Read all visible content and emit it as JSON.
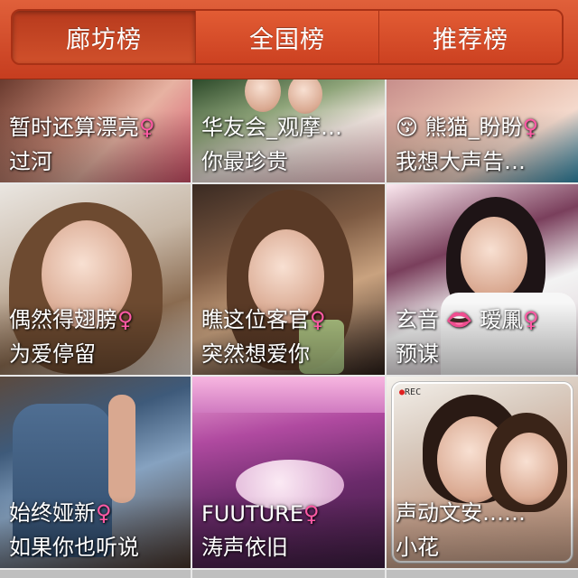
{
  "tabs": [
    {
      "label": "廊坊榜",
      "active": true
    },
    {
      "label": "全国榜",
      "active": false
    },
    {
      "label": "推荐榜",
      "active": false
    }
  ],
  "cards": [
    {
      "name": "暂时还算漂亮",
      "sub": "过河",
      "gender_symbol": "♀"
    },
    {
      "name": "华友会_观摩…",
      "sub": "你最珍贵",
      "gender_symbol": ""
    },
    {
      "name": "😚 熊猫_盼盼",
      "sub": "我想大声告…",
      "gender_symbol": "♀"
    },
    {
      "name": "偶然得翅膀",
      "sub": "为爱停留",
      "gender_symbol": "♀"
    },
    {
      "name": "瞧这位客官",
      "sub": "突然想爱你",
      "gender_symbol": "♀"
    },
    {
      "name": "玄音 👄 瑷凲",
      "sub": "预谋",
      "gender_symbol": "♀"
    },
    {
      "name": "始终娅新",
      "sub": "如果你也听说",
      "gender_symbol": "♀"
    },
    {
      "name": "FUUTURE",
      "sub": "涛声依旧",
      "gender_symbol": "♀"
    },
    {
      "name": "声动文安……",
      "sub": "小花",
      "gender_symbol": ""
    }
  ],
  "photo_overlay": {
    "rec_label": "REC"
  },
  "colors": {
    "header": "#d04a28",
    "female_symbol": "#ff5aa5"
  }
}
